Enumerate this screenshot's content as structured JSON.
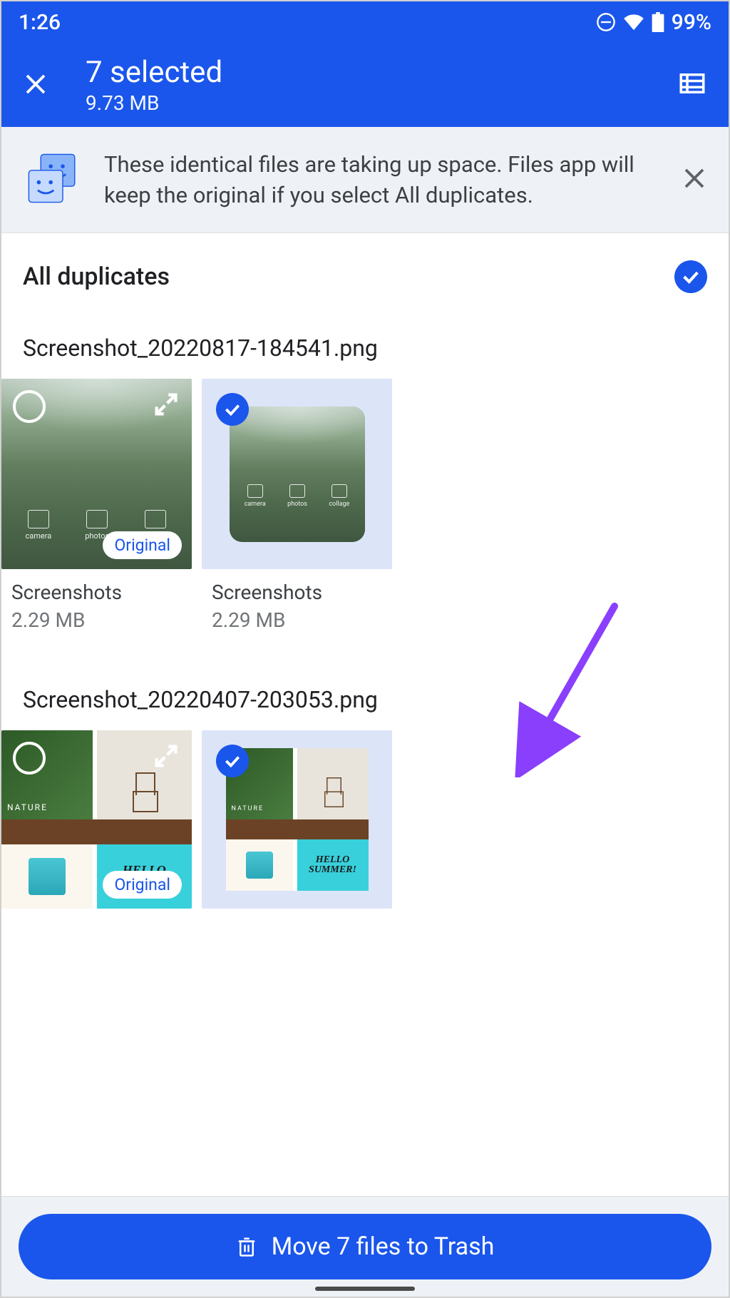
{
  "status": {
    "time": "1:26",
    "battery": "99%"
  },
  "header": {
    "title": "7 selected",
    "subtitle": "9.73 MB"
  },
  "banner": {
    "text": "These identical files are taking up space. Files app will keep the original if you select All duplicates."
  },
  "all_duplicates": {
    "label": "All duplicates",
    "selected": true
  },
  "groups": [
    {
      "filename": "Screenshot_20220817-184541.png",
      "items": [
        {
          "folder": "Screenshots",
          "size": "2.29 MB",
          "original": true,
          "selected": false,
          "original_label": "Original"
        },
        {
          "folder": "Screenshots",
          "size": "2.29 MB",
          "original": false,
          "selected": true
        }
      ]
    },
    {
      "filename": "Screenshot_20220407-203053.png",
      "items": [
        {
          "original": true,
          "selected": false,
          "original_label": "Original"
        },
        {
          "original": false,
          "selected": true
        }
      ]
    }
  ],
  "thumb_icons": {
    "a": "camera",
    "b": "photos",
    "c": "collage"
  },
  "collage": {
    "hello1": "HELLO",
    "hello2": "SUMMER!"
  },
  "action": {
    "label": "Move 7 files to Trash"
  }
}
